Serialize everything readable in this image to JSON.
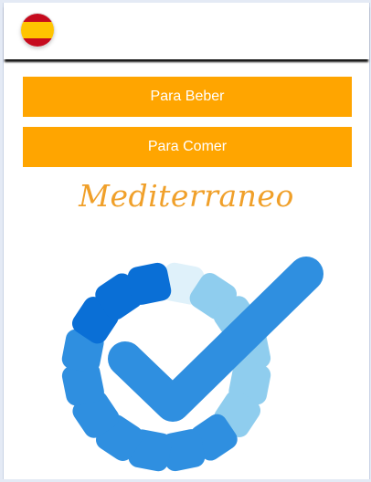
{
  "header": {
    "language_flag": "spain-flag-icon",
    "flag_colors": {
      "red": "#c60b1e",
      "yellow": "#ffc400"
    }
  },
  "menu": {
    "drinks_label": "Para Beber",
    "food_label": "Para Comer",
    "button_color": "#ffa500"
  },
  "brand": {
    "name": "Mediterraneo",
    "name_color": "#f0a02a",
    "logo_icon": "check-progress-ring-icon",
    "logo_colors": {
      "dark": "#0a6fd6",
      "mid": "#2f8fe0",
      "light": "#8fcdee",
      "faint": "#dff1fa"
    }
  }
}
